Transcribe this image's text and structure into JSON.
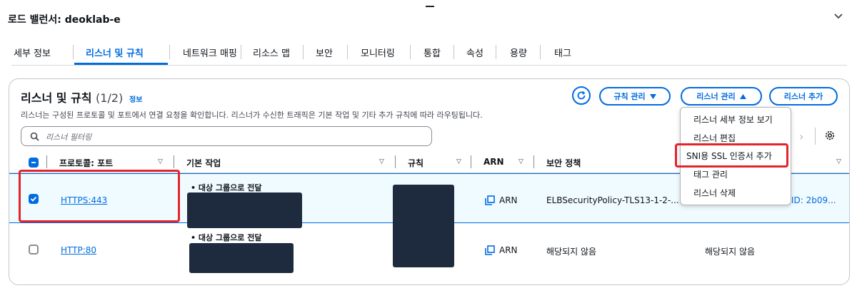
{
  "page": {
    "title": "로드 밸런서: deoklab-e"
  },
  "tabs": [
    {
      "label": "세부 정보"
    },
    {
      "label": "리스너 및 규칙"
    },
    {
      "label": "네트워크 매핑"
    },
    {
      "label": "리소스 맵"
    },
    {
      "label": "보안"
    },
    {
      "label": "모니터링"
    },
    {
      "label": "통합"
    },
    {
      "label": "속성"
    },
    {
      "label": "용량"
    },
    {
      "label": "태그"
    }
  ],
  "active_tab": "리스너 및 규칙",
  "panel": {
    "title": "리스너 및 규칙",
    "count": "(1/2)",
    "info": "정보",
    "description": "리스너는 구성된 프로토콜 및 포트에서 연결 요청을 확인합니다. 리스너가 수신한 트래픽은 기본 작업 및 기타 추가 규칙에 따라 라우팅됩니다.",
    "manage_rules": "규칙 관리",
    "manage_listener": "리스너 관리",
    "add_listener": "리스너 추가",
    "filter_placeholder": "리스너 필터링"
  },
  "table": {
    "columns": [
      "프로토콜: 포트",
      "기본 작업",
      "규칙",
      "ARN",
      "보안 정책"
    ],
    "rows": [
      {
        "protocol": "HTTPS:443",
        "action": "• 대상 그룹으로 전달",
        "arn": "ARN",
        "policy": "ELBSecurityPolicy-TLS13-1-2-...",
        "extra": "ID: 2b09...",
        "selected": true
      },
      {
        "protocol": "HTTP:80",
        "action": "• 대상 그룹으로 전달",
        "arn": "ARN",
        "policy": "해당되지 않음",
        "extra": "해당되지 않음",
        "selected": false
      }
    ]
  },
  "menu": {
    "items": [
      "리스너 세부 정보 보기",
      "리스너 편집",
      "SNI용 SSL 인증서 추가",
      "태그 관리",
      "리스너 삭제"
    ]
  },
  "colors": {
    "accent": "#006ce0",
    "highlight": "#e3242b",
    "redaction": "#1e2b3f"
  }
}
